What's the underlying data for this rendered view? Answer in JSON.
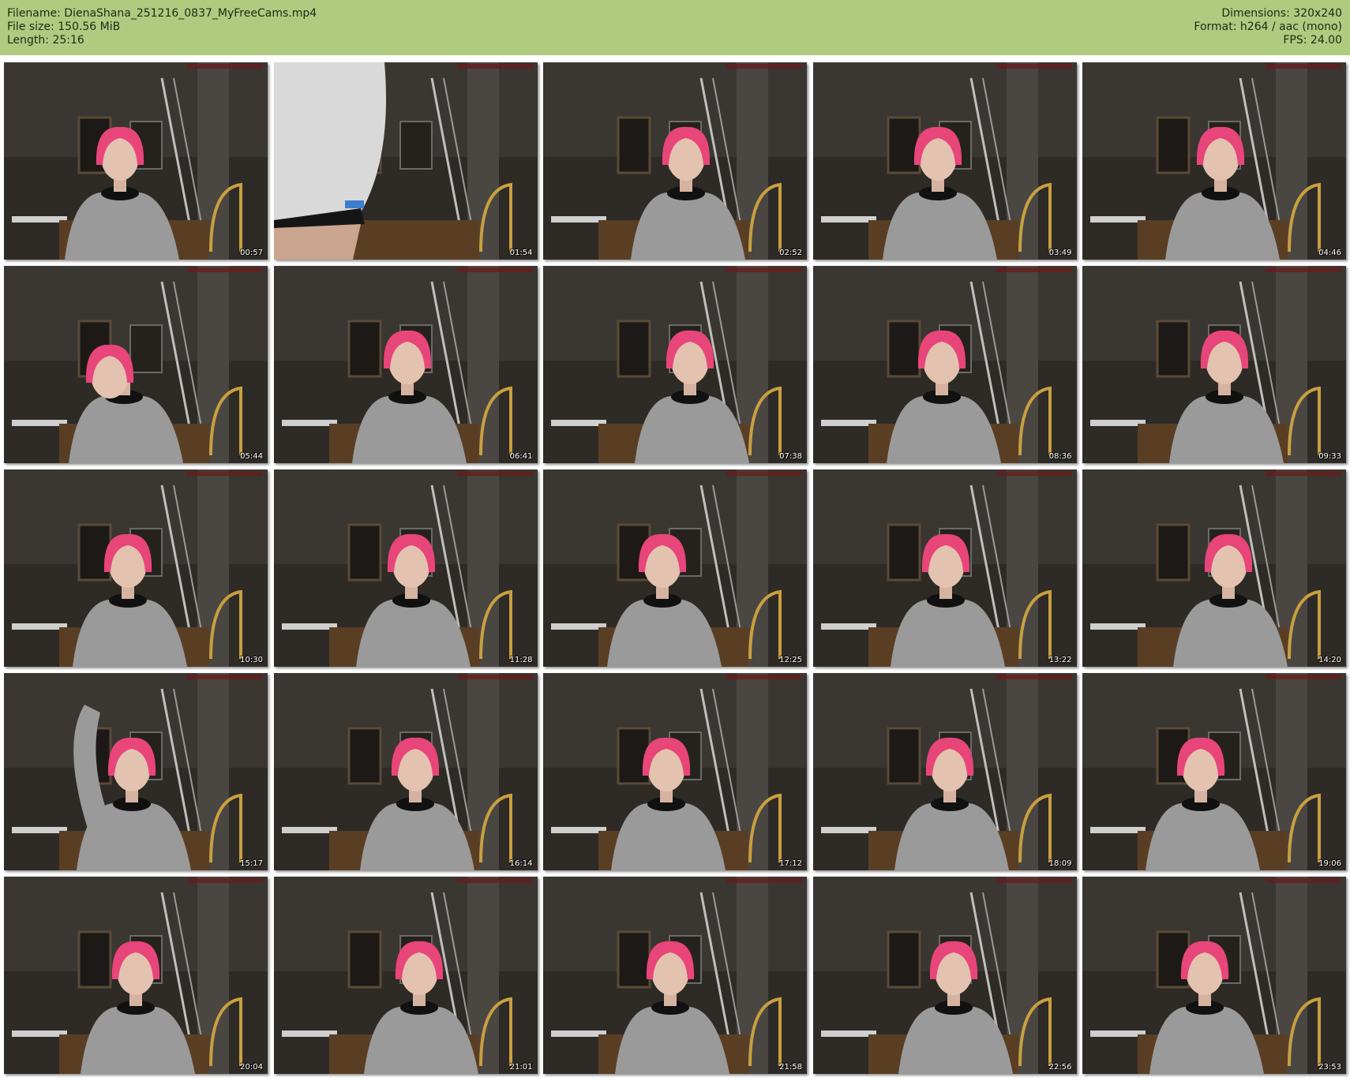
{
  "header": {
    "filename": "Filename: DienaShana_251216_0837_MyFreeCams.mp4",
    "filesize": "File size: 150.56 MiB",
    "length": "Length: 25:16",
    "dimensions": "Dimensions: 320x240",
    "format": "Format: h264 / aac (mono)",
    "fps": "FPS: 24.00"
  },
  "colors": {
    "header_bg": "#afcb80",
    "hair": "#e8457a",
    "sweater": "#9a9a9a",
    "room": "#2e2a26"
  },
  "thumbnails": [
    {
      "time": "00:57",
      "scene": "seated"
    },
    {
      "time": "01:54",
      "scene": "closeup-sweater"
    },
    {
      "time": "02:52",
      "scene": "seated"
    },
    {
      "time": "03:49",
      "scene": "seated"
    },
    {
      "time": "04:46",
      "scene": "seated"
    },
    {
      "time": "05:44",
      "scene": "leaning"
    },
    {
      "time": "06:41",
      "scene": "seated"
    },
    {
      "time": "07:38",
      "scene": "seated"
    },
    {
      "time": "08:36",
      "scene": "seated"
    },
    {
      "time": "09:33",
      "scene": "seated"
    },
    {
      "time": "10:30",
      "scene": "seated"
    },
    {
      "time": "11:28",
      "scene": "seated"
    },
    {
      "time": "12:25",
      "scene": "seated"
    },
    {
      "time": "13:22",
      "scene": "seated"
    },
    {
      "time": "14:20",
      "scene": "seated"
    },
    {
      "time": "15:17",
      "scene": "arm-raised"
    },
    {
      "time": "16:14",
      "scene": "seated"
    },
    {
      "time": "17:12",
      "scene": "seated"
    },
    {
      "time": "18:09",
      "scene": "seated"
    },
    {
      "time": "19:06",
      "scene": "seated"
    },
    {
      "time": "20:04",
      "scene": "seated"
    },
    {
      "time": "21:01",
      "scene": "seated"
    },
    {
      "time": "21:58",
      "scene": "seated"
    },
    {
      "time": "22:56",
      "scene": "seated"
    },
    {
      "time": "23:53",
      "scene": "seated"
    }
  ]
}
